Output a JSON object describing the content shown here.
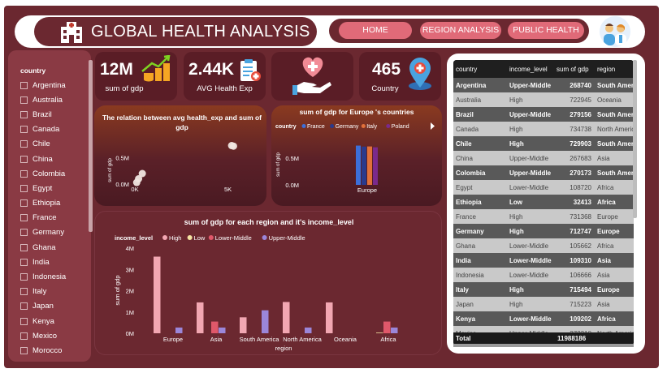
{
  "header": {
    "title": "GLOBAL HEALTH ANALYSIS",
    "nav": [
      "HOME",
      "REGION ANALYSIS",
      "PUBLIC HEALTH"
    ]
  },
  "slicer": {
    "title": "country",
    "items": [
      "Argentina",
      "Australia",
      "Brazil",
      "Canada",
      "Chile",
      "China",
      "Colombia",
      "Egypt",
      "Ethiopia",
      "France",
      "Germany",
      "Ghana",
      "India",
      "Indonesia",
      "Italy",
      "Japan",
      "Kenya",
      "Mexico",
      "Morocco"
    ]
  },
  "kpis": [
    {
      "value": "12M",
      "label": "sum of gdp",
      "icon": "bar-growth-icon"
    },
    {
      "value": "2.44K",
      "label": "AVG Health Exp",
      "icon": "clipboard-icon"
    },
    {
      "value": "",
      "label": "",
      "icon": "heart-hand-icon"
    },
    {
      "value": "465",
      "label": "Country",
      "icon": "location-pin-icon"
    }
  ],
  "charts": {
    "scatter_title": "The relation between avg health_exp and sum of gdp",
    "europe_title": "sum of gdp for Europe 's countries",
    "europe_legend_label": "country",
    "region_title": "sum of gdp for each region and it's income_level",
    "region_legend_label": "income_level"
  },
  "chart_data": [
    {
      "type": "scatter",
      "title": "The relation between avg health_exp and sum of gdp",
      "xlabel": "",
      "ylabel": "sum of gdp",
      "x_ticks": [
        "0K",
        "5K"
      ],
      "y_ticks": [
        "0.0M",
        "0.5M"
      ],
      "points": [
        {
          "x": 100,
          "y": 30000
        },
        {
          "x": 200,
          "y": 100000
        },
        {
          "x": 400,
          "y": 200000
        },
        {
          "x": 5200,
          "y": 730000
        },
        {
          "x": 5300,
          "y": 720000
        }
      ]
    },
    {
      "type": "bar",
      "title": "sum of gdp for Europe 's countries",
      "categories": [
        "Europe"
      ],
      "xlabel": "",
      "ylabel": "sum of gdp",
      "y_ticks": [
        "0.0M",
        "0.5M"
      ],
      "series": [
        {
          "name": "France",
          "values": [
            731368
          ],
          "color": "#3c6fd9"
        },
        {
          "name": "Germany",
          "values": [
            712747
          ],
          "color": "#2a3a8c"
        },
        {
          "name": "Italy",
          "values": [
            715494
          ],
          "color": "#e0703a"
        },
        {
          "name": "Poland",
          "values": [
            700000
          ],
          "color": "#7a2a8c"
        }
      ]
    },
    {
      "type": "bar",
      "title": "sum of gdp for each region and it's income_level",
      "xlabel": "region",
      "ylabel": "sum of gdp",
      "y_ticks": [
        "0M",
        "1M",
        "2M",
        "3M",
        "4M"
      ],
      "ylim": [
        0,
        4
      ],
      "categories": [
        "Europe",
        "Asia",
        "South America",
        "North America",
        "Oceania",
        "Africa"
      ],
      "series": [
        {
          "name": "High",
          "values": [
            3.6,
            1.45,
            0.75,
            1.47,
            1.45,
            0.0
          ],
          "color": "#f2a7b2"
        },
        {
          "name": "Low",
          "values": [
            0,
            0,
            0,
            0,
            0,
            0.03
          ],
          "color": "#f5e4a3"
        },
        {
          "name": "Lower-Middle",
          "values": [
            0,
            0.55,
            0,
            0,
            0,
            0.55
          ],
          "color": "#e0586a"
        },
        {
          "name": "Upper-Middle",
          "values": [
            0.27,
            0.27,
            1.08,
            0.27,
            0,
            0.27
          ],
          "color": "#9b86d9"
        }
      ]
    }
  ],
  "table": {
    "columns": [
      "country",
      "income_level",
      "sum of gdp",
      "region"
    ],
    "rows": [
      [
        "Argentina",
        "Upper-Middle",
        "268740",
        "South America"
      ],
      [
        "Australia",
        "High",
        "722945",
        "Oceania"
      ],
      [
        "Brazil",
        "Upper-Middle",
        "279156",
        "South America"
      ],
      [
        "Canada",
        "High",
        "734738",
        "North America"
      ],
      [
        "Chile",
        "High",
        "729903",
        "South America"
      ],
      [
        "China",
        "Upper-Middle",
        "267683",
        "Asia"
      ],
      [
        "Colombia",
        "Upper-Middle",
        "270173",
        "South America"
      ],
      [
        "Egypt",
        "Lower-Middle",
        "108720",
        "Africa"
      ],
      [
        "Ethiopia",
        "Low",
        "32413",
        "Africa"
      ],
      [
        "France",
        "High",
        "731368",
        "Europe"
      ],
      [
        "Germany",
        "High",
        "712747",
        "Europe"
      ],
      [
        "Ghana",
        "Lower-Middle",
        "105662",
        "Africa"
      ],
      [
        "India",
        "Lower-Middle",
        "109310",
        "Asia"
      ],
      [
        "Indonesia",
        "Lower-Middle",
        "106666",
        "Asia"
      ],
      [
        "Italy",
        "High",
        "715494",
        "Europe"
      ],
      [
        "Japan",
        "High",
        "715223",
        "Asia"
      ],
      [
        "Kenya",
        "Lower-Middle",
        "109202",
        "Africa"
      ],
      [
        "Mexico",
        "Upper-Middle",
        "272210",
        "North America"
      ]
    ],
    "total_label": "Total",
    "total_value": "11988186"
  }
}
